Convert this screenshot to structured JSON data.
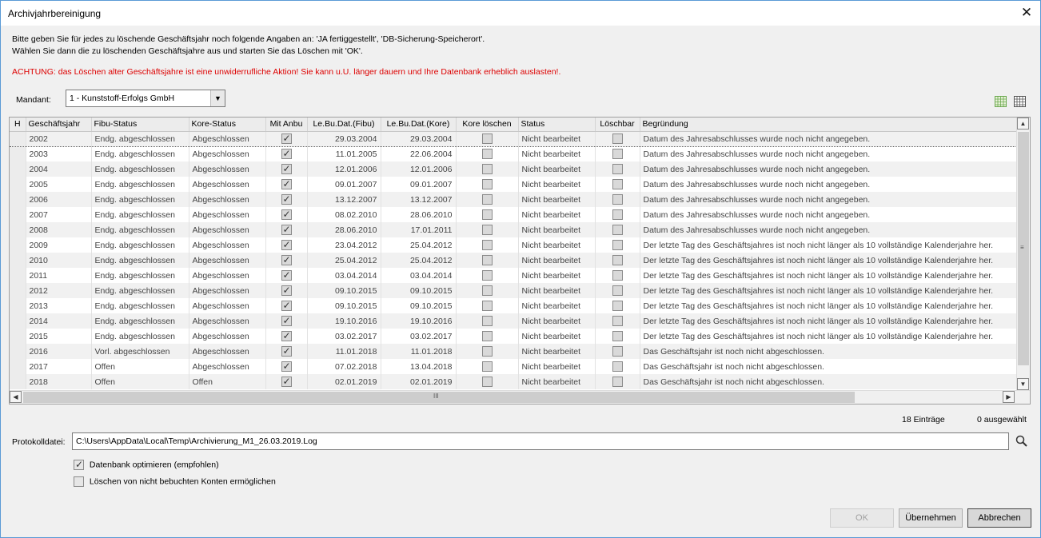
{
  "window": {
    "title": "Archivjahrbereinigung",
    "close_icon": "close-icon"
  },
  "intro": {
    "line1": "Bitte geben Sie für jedes zu löschende Geschäftsjahr noch folgende Angaben an: 'JA fertiggestellt', 'DB-Sicherung-Speicherort'.",
    "line2": "Wählen Sie dann die zu löschenden Geschäftsjahre aus und starten Sie das Löschen mit 'OK'.",
    "warning": "ACHTUNG: das Löschen alter Geschäftsjahre ist eine unwiderrufliche Aktion! Sie kann u.U. länger dauern und Ihre Datenbank erheblich auslasten!."
  },
  "mandant": {
    "label": "Mandant:",
    "value": "1 - Kunststoff-Erfolgs GmbH"
  },
  "table": {
    "columns": [
      "H",
      "Geschäftsjahr",
      "Fibu-Status",
      "Kore-Status",
      "Mit Anbu",
      "Le.Bu.Dat.(Fibu)",
      "Le.Bu.Dat.(Kore)",
      "Kore löschen",
      "Status",
      "Löschbar",
      "Begründung"
    ],
    "rows": [
      {
        "year": "2002",
        "fibu": "Endg. abgeschlossen",
        "kore": "Abgeschlossen",
        "anbu": true,
        "fibu_date": "29.03.2004",
        "kore_date": "29.03.2004",
        "kore_del": false,
        "status": "Nicht bearbeitet",
        "loeschbar": false,
        "reason": "Datum des Jahresabschlusses wurde noch nicht angegeben."
      },
      {
        "year": "2003",
        "fibu": "Endg. abgeschlossen",
        "kore": "Abgeschlossen",
        "anbu": true,
        "fibu_date": "11.01.2005",
        "kore_date": "22.06.2004",
        "kore_del": false,
        "status": "Nicht bearbeitet",
        "loeschbar": false,
        "reason": "Datum des Jahresabschlusses wurde noch nicht angegeben."
      },
      {
        "year": "2004",
        "fibu": "Endg. abgeschlossen",
        "kore": "Abgeschlossen",
        "anbu": true,
        "fibu_date": "12.01.2006",
        "kore_date": "12.01.2006",
        "kore_del": false,
        "status": "Nicht bearbeitet",
        "loeschbar": false,
        "reason": "Datum des Jahresabschlusses wurde noch nicht angegeben."
      },
      {
        "year": "2005",
        "fibu": "Endg. abgeschlossen",
        "kore": "Abgeschlossen",
        "anbu": true,
        "fibu_date": "09.01.2007",
        "kore_date": "09.01.2007",
        "kore_del": false,
        "status": "Nicht bearbeitet",
        "loeschbar": false,
        "reason": "Datum des Jahresabschlusses wurde noch nicht angegeben."
      },
      {
        "year": "2006",
        "fibu": "Endg. abgeschlossen",
        "kore": "Abgeschlossen",
        "anbu": true,
        "fibu_date": "13.12.2007",
        "kore_date": "13.12.2007",
        "kore_del": false,
        "status": "Nicht bearbeitet",
        "loeschbar": false,
        "reason": "Datum des Jahresabschlusses wurde noch nicht angegeben."
      },
      {
        "year": "2007",
        "fibu": "Endg. abgeschlossen",
        "kore": "Abgeschlossen",
        "anbu": true,
        "fibu_date": "08.02.2010",
        "kore_date": "28.06.2010",
        "kore_del": false,
        "status": "Nicht bearbeitet",
        "loeschbar": false,
        "reason": "Datum des Jahresabschlusses wurde noch nicht angegeben."
      },
      {
        "year": "2008",
        "fibu": "Endg. abgeschlossen",
        "kore": "Abgeschlossen",
        "anbu": true,
        "fibu_date": "28.06.2010",
        "kore_date": "17.01.2011",
        "kore_del": false,
        "status": "Nicht bearbeitet",
        "loeschbar": false,
        "reason": "Datum des Jahresabschlusses wurde noch nicht angegeben."
      },
      {
        "year": "2009",
        "fibu": "Endg. abgeschlossen",
        "kore": "Abgeschlossen",
        "anbu": true,
        "fibu_date": "23.04.2012",
        "kore_date": "25.04.2012",
        "kore_del": false,
        "status": "Nicht bearbeitet",
        "loeschbar": false,
        "reason": "Der letzte Tag des Geschäftsjahres ist noch nicht länger als 10 vollständige Kalenderjahre her."
      },
      {
        "year": "2010",
        "fibu": "Endg. abgeschlossen",
        "kore": "Abgeschlossen",
        "anbu": true,
        "fibu_date": "25.04.2012",
        "kore_date": "25.04.2012",
        "kore_del": false,
        "status": "Nicht bearbeitet",
        "loeschbar": false,
        "reason": "Der letzte Tag des Geschäftsjahres ist noch nicht länger als 10 vollständige Kalenderjahre her."
      },
      {
        "year": "2011",
        "fibu": "Endg. abgeschlossen",
        "kore": "Abgeschlossen",
        "anbu": true,
        "fibu_date": "03.04.2014",
        "kore_date": "03.04.2014",
        "kore_del": false,
        "status": "Nicht bearbeitet",
        "loeschbar": false,
        "reason": "Der letzte Tag des Geschäftsjahres ist noch nicht länger als 10 vollständige Kalenderjahre her."
      },
      {
        "year": "2012",
        "fibu": "Endg. abgeschlossen",
        "kore": "Abgeschlossen",
        "anbu": true,
        "fibu_date": "09.10.2015",
        "kore_date": "09.10.2015",
        "kore_del": false,
        "status": "Nicht bearbeitet",
        "loeschbar": false,
        "reason": "Der letzte Tag des Geschäftsjahres ist noch nicht länger als 10 vollständige Kalenderjahre her."
      },
      {
        "year": "2013",
        "fibu": "Endg. abgeschlossen",
        "kore": "Abgeschlossen",
        "anbu": true,
        "fibu_date": "09.10.2015",
        "kore_date": "09.10.2015",
        "kore_del": false,
        "status": "Nicht bearbeitet",
        "loeschbar": false,
        "reason": "Der letzte Tag des Geschäftsjahres ist noch nicht länger als 10 vollständige Kalenderjahre her."
      },
      {
        "year": "2014",
        "fibu": "Endg. abgeschlossen",
        "kore": "Abgeschlossen",
        "anbu": true,
        "fibu_date": "19.10.2016",
        "kore_date": "19.10.2016",
        "kore_del": false,
        "status": "Nicht bearbeitet",
        "loeschbar": false,
        "reason": "Der letzte Tag des Geschäftsjahres ist noch nicht länger als 10 vollständige Kalenderjahre her."
      },
      {
        "year": "2015",
        "fibu": "Endg. abgeschlossen",
        "kore": "Abgeschlossen",
        "anbu": true,
        "fibu_date": "03.02.2017",
        "kore_date": "03.02.2017",
        "kore_del": false,
        "status": "Nicht bearbeitet",
        "loeschbar": false,
        "reason": "Der letzte Tag des Geschäftsjahres ist noch nicht länger als 10 vollständige Kalenderjahre her."
      },
      {
        "year": "2016",
        "fibu": "Vorl. abgeschlossen",
        "kore": "Abgeschlossen",
        "anbu": true,
        "fibu_date": "11.01.2018",
        "kore_date": "11.01.2018",
        "kore_del": false,
        "status": "Nicht bearbeitet",
        "loeschbar": false,
        "reason": "Das Geschäftsjahr ist noch nicht abgeschlossen."
      },
      {
        "year": "2017",
        "fibu": "Offen",
        "kore": "Abgeschlossen",
        "anbu": true,
        "fibu_date": "07.02.2018",
        "kore_date": "13.04.2018",
        "kore_del": false,
        "status": "Nicht bearbeitet",
        "loeschbar": false,
        "reason": "Das Geschäftsjahr ist noch nicht abgeschlossen."
      },
      {
        "year": "2018",
        "fibu": "Offen",
        "kore": "Offen",
        "anbu": true,
        "fibu_date": "02.01.2019",
        "kore_date": "02.01.2019",
        "kore_del": false,
        "status": "Nicht bearbeitet",
        "loeschbar": false,
        "reason": "Das Geschäftsjahr ist noch nicht abgeschlossen."
      }
    ],
    "scroll_grip": "III",
    "scroll_grip_v": "≡"
  },
  "footer": {
    "entries": "18 Einträge",
    "selected": "0 ausgewählt",
    "protokoll_label": "Protokolldatei:",
    "protokoll_value": "C:\\Users\\AppData\\Local\\Temp\\Archivierung_M1_26.03.2019.Log",
    "opt_optimize": {
      "label": "Datenbank optimieren (empfohlen)",
      "checked": true
    },
    "opt_delete_unbooked": {
      "label": "Löschen von nicht bebuchten Konten ermöglichen",
      "checked": false
    }
  },
  "buttons": {
    "ok": "OK",
    "apply": "Übernehmen",
    "cancel": "Abbrechen"
  },
  "colors": {
    "warning": "#dd0000",
    "window_border": "#5a9ad6",
    "accent_green": "#6aa84f"
  }
}
